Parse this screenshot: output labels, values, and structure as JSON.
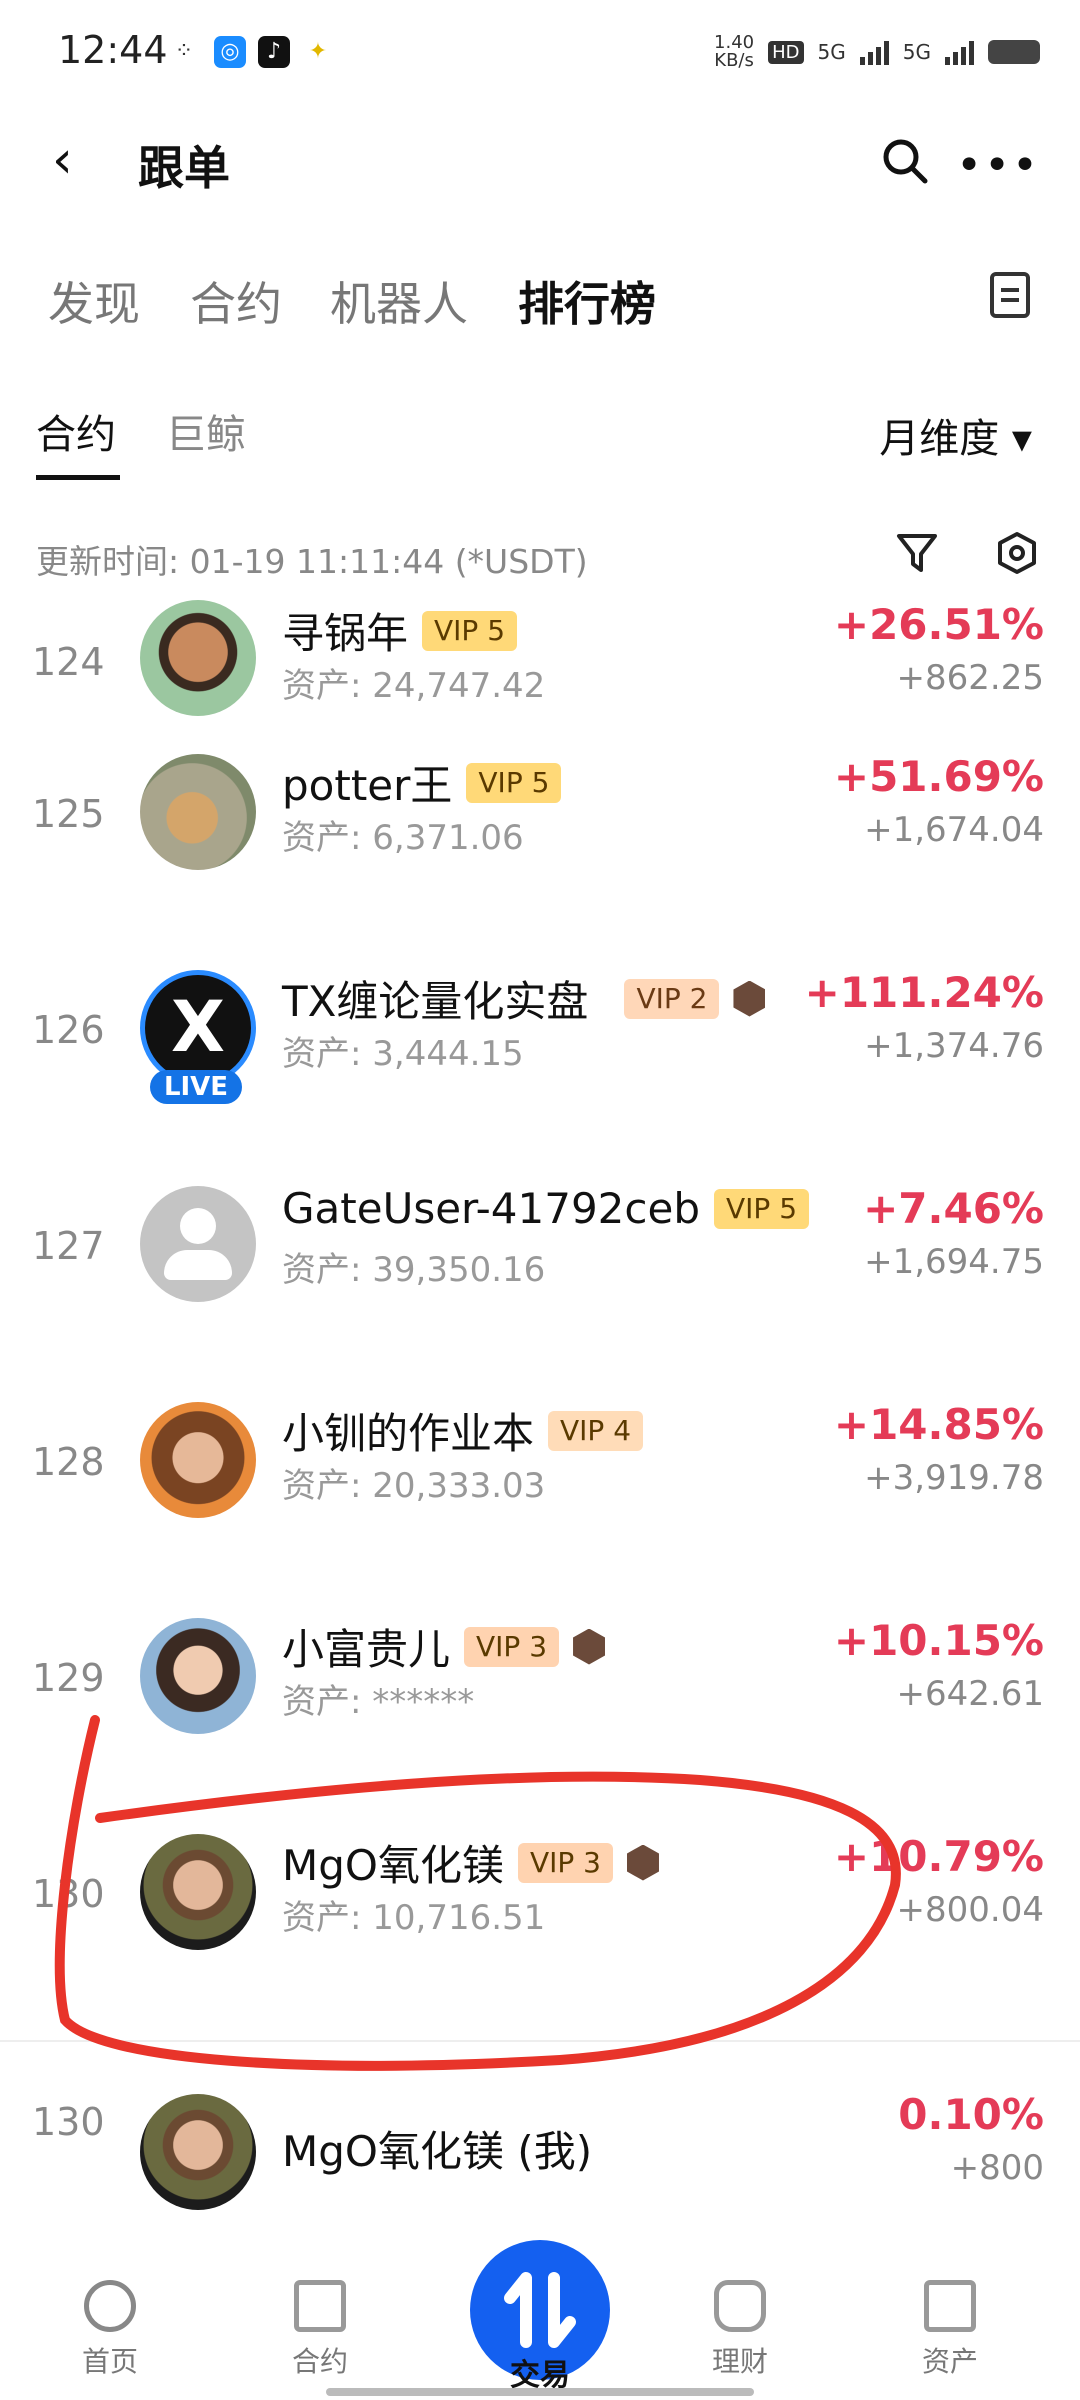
{
  "status": {
    "time": "12:44",
    "speed_top": "1.40",
    "speed_unit": "KB/s",
    "net1": "5G",
    "net2": "5G",
    "hd": "HD"
  },
  "header": {
    "title": "跟单"
  },
  "top_tabs": [
    "发现",
    "合约",
    "机器人",
    "排行榜"
  ],
  "sub_tabs": [
    "合约",
    "巨鲸"
  ],
  "period": "月维度 ▾",
  "update_text": "更新时间: 01-19 11:11:44 (*USDT)",
  "rows": [
    {
      "rank": "124",
      "name": "寻锅年",
      "vip": "VIP 5",
      "asset": "资产: 24,747.42",
      "pct": "+26.51%",
      "abs": "+862.25"
    },
    {
      "rank": "125",
      "name": "potter王",
      "vip": "VIP 5",
      "asset": "资产: 6,371.06",
      "pct": "+51.69%",
      "abs": "+1,674.04"
    },
    {
      "rank": "126",
      "name": "TX缠论量化实盘",
      "vip": "VIP 2",
      "asset": "资产: 3,444.15",
      "pct": "+111.24%",
      "abs": "+1,374.76",
      "live": "LIVE",
      "avatar_letter": "X"
    },
    {
      "rank": "127",
      "name": "GateUser-41792ceb",
      "vip": "VIP 5",
      "asset": "资产: 39,350.16",
      "pct": "+7.46%",
      "abs": "+1,694.75"
    },
    {
      "rank": "128",
      "name": "小钏的作业本",
      "vip": "VIP 4",
      "asset": "资产: 20,333.03",
      "pct": "+14.85%",
      "abs": "+3,919.78"
    },
    {
      "rank": "129",
      "name": "小富贵儿",
      "vip": "VIP 3",
      "asset": "资产: ******",
      "pct": "+10.15%",
      "abs": "+642.61"
    },
    {
      "rank": "130",
      "name": "MgO氧化镁",
      "vip": "VIP 3",
      "asset": "资产: 10,716.51",
      "pct": "+10.79%",
      "abs": "+800.04"
    }
  ],
  "my_row": {
    "rank": "130",
    "name": "MgO氧化镁 (我)",
    "pct": "0.10%",
    "abs": "+800"
  },
  "nav": {
    "home": "首页",
    "contract": "合约",
    "trade": "交易",
    "finance": "理财",
    "assets": "资产"
  },
  "colors": {
    "up": "#e43b57",
    "vip_bg": "#ffd978",
    "accent": "#1460f0",
    "annotation": "#e8342a"
  }
}
